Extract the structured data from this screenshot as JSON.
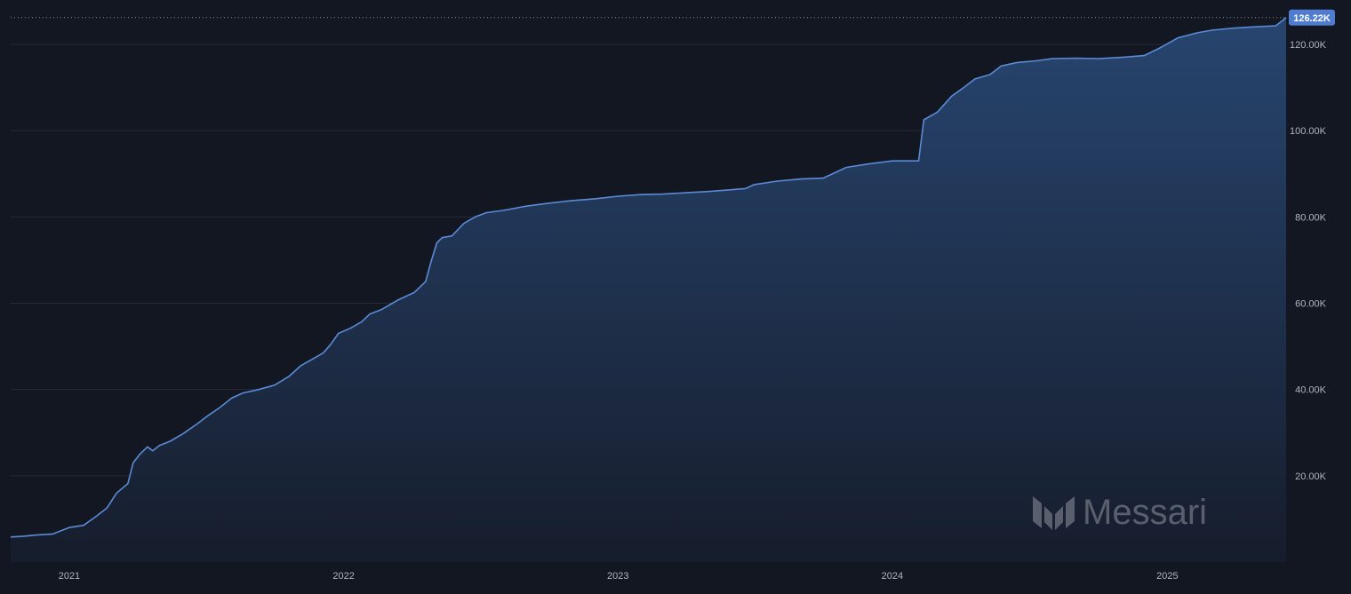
{
  "colors": {
    "background": "#131722",
    "line": "#5b8bd6",
    "area_top": "#27456f",
    "area_bottom": "#161d2c",
    "grid": "#262b3a",
    "last_value_badge": "#4f7ccf"
  },
  "watermark": {
    "text": "Messari",
    "icon": "messari-logo-icon"
  },
  "chart_data": {
    "type": "area",
    "title": "",
    "xlabel": "",
    "ylabel": "",
    "xlim": [
      "2020-10-15",
      "2025-06-08"
    ],
    "ylim": [
      0,
      124000
    ],
    "grid": "horizontal",
    "y_ticks": [
      {
        "value": 20000,
        "label": "20.00K"
      },
      {
        "value": 40000,
        "label": "40.00K"
      },
      {
        "value": 60000,
        "label": "60.00K"
      },
      {
        "value": 80000,
        "label": "80.00K"
      },
      {
        "value": 100000,
        "label": "100.00K"
      },
      {
        "value": 120000,
        "label": "120.00K"
      }
    ],
    "x_ticks": [
      {
        "value": "2021-01-01",
        "label": "2021"
      },
      {
        "value": "2022-01-01",
        "label": "2022"
      },
      {
        "value": "2023-01-01",
        "label": "2023"
      },
      {
        "value": "2024-01-01",
        "label": "2024"
      },
      {
        "value": "2025-01-01",
        "label": "2025"
      }
    ],
    "last_value": {
      "value": 126220,
      "label": "126.22K"
    },
    "series": [
      {
        "points": [
          [
            "2020-10-15",
            5800
          ],
          [
            "2020-11-01",
            6000
          ],
          [
            "2020-11-20",
            6300
          ],
          [
            "2020-12-10",
            6500
          ],
          [
            "2021-01-01",
            8000
          ],
          [
            "2021-01-20",
            8500
          ],
          [
            "2021-02-05",
            10500
          ],
          [
            "2021-02-20",
            12500
          ],
          [
            "2021-03-05",
            16000
          ],
          [
            "2021-03-20",
            18200
          ],
          [
            "2021-03-27",
            23000
          ],
          [
            "2021-04-05",
            25000
          ],
          [
            "2021-04-15",
            26700
          ],
          [
            "2021-04-22",
            25800
          ],
          [
            "2021-05-01",
            27000
          ],
          [
            "2021-05-15",
            28000
          ],
          [
            "2021-06-01",
            29700
          ],
          [
            "2021-06-20",
            32000
          ],
          [
            "2021-07-05",
            34000
          ],
          [
            "2021-07-20",
            35800
          ],
          [
            "2021-08-05",
            38000
          ],
          [
            "2021-08-20",
            39200
          ],
          [
            "2021-09-10",
            40000
          ],
          [
            "2021-10-01",
            41000
          ],
          [
            "2021-10-20",
            43000
          ],
          [
            "2021-11-05",
            45500
          ],
          [
            "2021-11-20",
            47000
          ],
          [
            "2021-12-05",
            48500
          ],
          [
            "2021-12-15",
            50500
          ],
          [
            "2021-12-25",
            53000
          ],
          [
            "2022-01-10",
            54200
          ],
          [
            "2022-01-25",
            55700
          ],
          [
            "2022-02-05",
            57500
          ],
          [
            "2022-02-20",
            58500
          ],
          [
            "2022-03-05",
            59800
          ],
          [
            "2022-03-15",
            60800
          ],
          [
            "2022-04-05",
            62500
          ],
          [
            "2022-04-20",
            65000
          ],
          [
            "2022-04-28",
            70000
          ],
          [
            "2022-05-05",
            74000
          ],
          [
            "2022-05-12",
            75200
          ],
          [
            "2022-05-25",
            75600
          ],
          [
            "2022-06-10",
            78500
          ],
          [
            "2022-06-25",
            80000
          ],
          [
            "2022-07-10",
            81000
          ],
          [
            "2022-08-01",
            81500
          ],
          [
            "2022-09-01",
            82500
          ],
          [
            "2022-10-01",
            83200
          ],
          [
            "2022-11-01",
            83800
          ],
          [
            "2022-12-01",
            84200
          ],
          [
            "2023-01-01",
            84800
          ],
          [
            "2023-02-01",
            85200
          ],
          [
            "2023-03-01",
            85300
          ],
          [
            "2023-04-01",
            85600
          ],
          [
            "2023-05-01",
            85900
          ],
          [
            "2023-06-01",
            86300
          ],
          [
            "2023-06-20",
            86600
          ],
          [
            "2023-07-01",
            87500
          ],
          [
            "2023-08-01",
            88300
          ],
          [
            "2023-09-01",
            88800
          ],
          [
            "2023-10-01",
            89000
          ],
          [
            "2023-11-01",
            91500
          ],
          [
            "2023-12-01",
            92300
          ],
          [
            "2024-01-01",
            93000
          ],
          [
            "2024-02-05",
            93000
          ],
          [
            "2024-02-12",
            102500
          ],
          [
            "2024-03-01",
            104300
          ],
          [
            "2024-03-20",
            108000
          ],
          [
            "2024-04-05",
            110000
          ],
          [
            "2024-04-20",
            112000
          ],
          [
            "2024-05-10",
            113000
          ],
          [
            "2024-05-25",
            115000
          ],
          [
            "2024-06-15",
            115800
          ],
          [
            "2024-07-10",
            116200
          ],
          [
            "2024-08-01",
            116700
          ],
          [
            "2024-09-01",
            116800
          ],
          [
            "2024-10-01",
            116700
          ],
          [
            "2024-11-01",
            117000
          ],
          [
            "2024-12-01",
            117400
          ],
          [
            "2024-12-20",
            119000
          ],
          [
            "2025-01-15",
            121500
          ],
          [
            "2025-02-10",
            122700
          ],
          [
            "2025-03-01",
            123300
          ],
          [
            "2025-04-01",
            123800
          ],
          [
            "2025-05-01",
            124100
          ],
          [
            "2025-05-25",
            124300
          ],
          [
            "2025-06-03",
            125500
          ],
          [
            "2025-06-08",
            126220
          ]
        ]
      }
    ]
  }
}
